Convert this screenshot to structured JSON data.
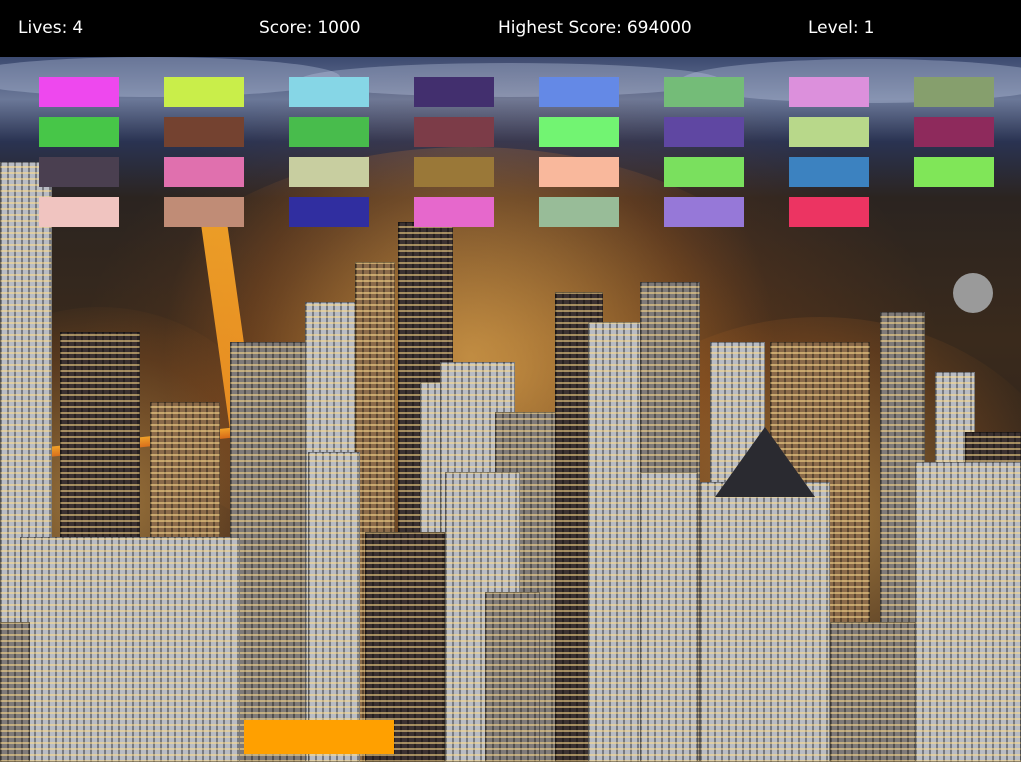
{
  "hud": {
    "lives_label": "Lives:",
    "lives_value": "4",
    "score_label": "Score:",
    "score_value": "1000",
    "high_score_label": "Highest Score:",
    "high_score_value": "694000",
    "level_label": "Level:",
    "level_value": "1"
  },
  "colors": {
    "hud_background": "#000000",
    "hud_text": "#ffffff",
    "paddle": "#ffa000",
    "ball": "#9a9a9a"
  },
  "bricks": [
    [
      "#ee48ee",
      "#c9ee4a",
      "#86d6e6",
      "#422f6e",
      "#6489e6",
      "#74bc78",
      "#dc90dc",
      "#869f6d"
    ],
    [
      "#47c648",
      "#744230",
      "#48bc4c",
      "#7c3c48",
      "#72f472",
      "#5f47a2",
      "#b8d88a",
      "#8e2a5c"
    ],
    [
      "#4a3f50",
      "#e070ae",
      "#c8cea0",
      "#9a7838",
      "#f9b89c",
      "#7ae05e",
      "#3c82c0",
      "#80e658"
    ],
    [
      "#f0c4c0",
      "#c08c76",
      "#302ea0",
      "#e668cc",
      "#98bc98",
      "#9678d8",
      "#ec3462",
      null
    ]
  ],
  "background_image": "night-city-skyline"
}
